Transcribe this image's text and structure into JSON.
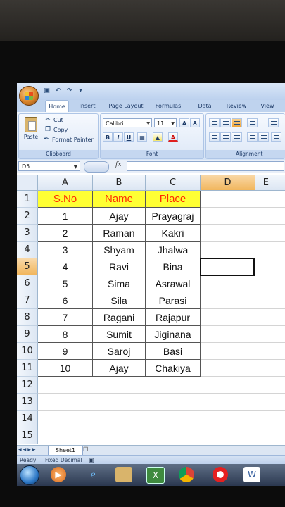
{
  "ribbon": {
    "tabs": [
      "Home",
      "Insert",
      "Page Layout",
      "Formulas",
      "Data",
      "Review",
      "View"
    ],
    "active_tab": "Home",
    "clipboard": {
      "paste": "Paste",
      "cut": "Cut",
      "copy": "Copy",
      "format_painter": "Format Painter",
      "label": "Clipboard"
    },
    "font": {
      "name": "Calibri",
      "size": "11",
      "bold": "B",
      "italic": "I",
      "underline": "U",
      "grow": "A",
      "shrink": "A",
      "color": "A",
      "label": "Font"
    },
    "alignment_label": "Alignment"
  },
  "formula_bar": {
    "name_box": "D5",
    "fx": "fx",
    "value": ""
  },
  "sheet": {
    "columns": [
      "A",
      "B",
      "C",
      "D",
      "E"
    ],
    "selected_column": "D",
    "selected_row": "5",
    "row_numbers": [
      "1",
      "2",
      "3",
      "4",
      "5",
      "6",
      "7",
      "8",
      "9",
      "10",
      "11",
      "12",
      "13",
      "14",
      "15"
    ],
    "header": [
      "S.No",
      "Name",
      "Place"
    ],
    "rows": [
      [
        "1",
        "Ajay",
        "Prayagraj"
      ],
      [
        "2",
        "Raman",
        "Kakri"
      ],
      [
        "3",
        "Shyam",
        "Jhalwa"
      ],
      [
        "4",
        "Ravi",
        "Bina"
      ],
      [
        "5",
        "Sima",
        "Asrawal"
      ],
      [
        "6",
        "Sila",
        "Parasi"
      ],
      [
        "7",
        "Ragani",
        "Rajapur"
      ],
      [
        "8",
        "Sumit",
        "Jiginana"
      ],
      [
        "9",
        "Saroj",
        "Basi"
      ],
      [
        "10",
        "Ajay",
        "Chakiya"
      ]
    ],
    "header_fill": "#ffff33",
    "header_text_color": "#ff2a00"
  },
  "sheet_tabs": {
    "tabs": [
      "Sheet1"
    ]
  },
  "status": {
    "ready": "Ready",
    "mode": "Fixed Decimal"
  }
}
